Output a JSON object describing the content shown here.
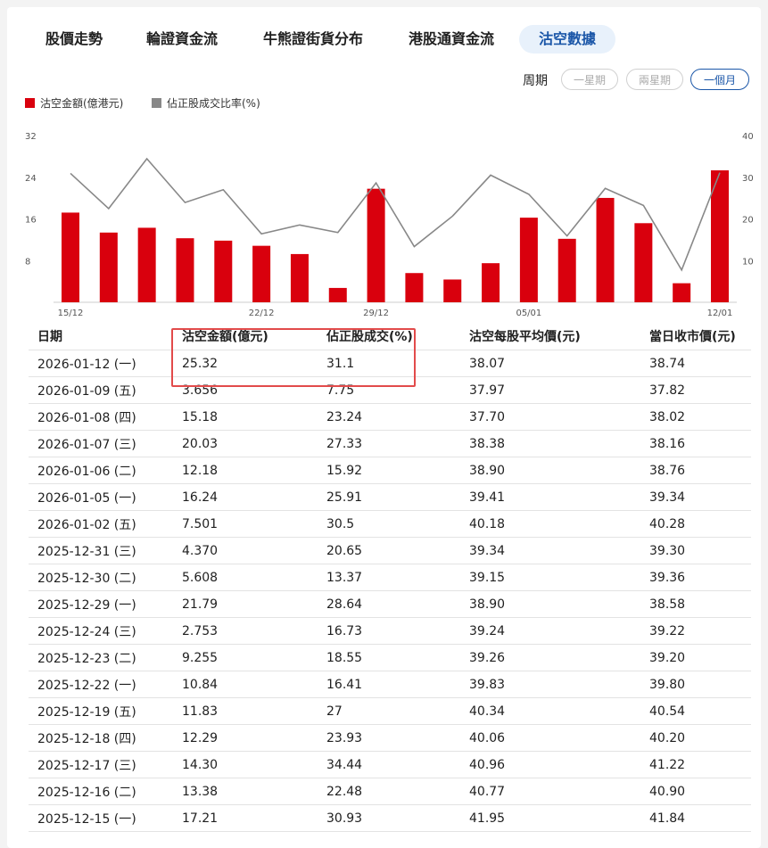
{
  "tabs": [
    "股價走勢",
    "輪證資金流",
    "牛熊證街貨分布",
    "港股通資金流",
    "沽空數據"
  ],
  "active_tab": 4,
  "period": {
    "label": "周期",
    "options": [
      "一星期",
      "兩星期",
      "一個月"
    ],
    "selected": 2
  },
  "legend": {
    "bar": "沽空金額(億港元)",
    "line": "佔正股成交比率(%)"
  },
  "colors": {
    "bar": "#d9000d",
    "line": "#888888",
    "accent": "#1a56a8",
    "highlight": "#e24b4b"
  },
  "chart_data": {
    "type": "bar",
    "x": [
      "2025-12-15",
      "2025-12-16",
      "2025-12-17",
      "2025-12-18",
      "2025-12-19",
      "2025-12-22",
      "2025-12-23",
      "2025-12-24",
      "2025-12-29",
      "2025-12-30",
      "2025-12-31",
      "2026-01-02",
      "2026-01-05",
      "2026-01-06",
      "2026-01-07",
      "2026-01-08",
      "2026-01-09",
      "2026-01-12"
    ],
    "x_tick_labels": [
      "15/12",
      "22/12",
      "29/12",
      "05/01",
      "12/01"
    ],
    "x_tick_indices": [
      0,
      5,
      8,
      12,
      17
    ],
    "series": [
      {
        "name": "沽空金額(億港元)",
        "type": "bar",
        "axis": "left",
        "values": [
          17.21,
          13.38,
          14.3,
          12.29,
          11.83,
          10.84,
          9.255,
          2.753,
          21.79,
          5.608,
          4.37,
          7.501,
          16.24,
          12.18,
          20.03,
          15.18,
          3.656,
          25.32
        ]
      },
      {
        "name": "佔正股成交比率(%)",
        "type": "line",
        "axis": "right",
        "values": [
          30.93,
          22.48,
          34.44,
          23.93,
          27,
          16.41,
          18.55,
          16.73,
          28.64,
          13.37,
          20.65,
          30.5,
          25.91,
          15.92,
          27.33,
          23.24,
          7.75,
          31.1
        ]
      }
    ],
    "y_left": {
      "ticks": [
        8,
        16,
        24,
        32
      ],
      "lim": [
        0,
        32
      ]
    },
    "y_right": {
      "ticks": [
        10,
        20,
        30,
        40
      ],
      "lim": [
        0,
        40
      ]
    }
  },
  "table": {
    "headers": [
      "日期",
      "沽空金額(億元)",
      "佔正股成交(%)",
      "沽空每股平均價(元)",
      "當日收市價(元)"
    ],
    "rows": [
      [
        "2026-01-12 (一)",
        "25.32",
        "31.1",
        "38.07",
        "38.74"
      ],
      [
        "2026-01-09 (五)",
        "3.656",
        "7.75",
        "37.97",
        "37.82"
      ],
      [
        "2026-01-08 (四)",
        "15.18",
        "23.24",
        "37.70",
        "38.02"
      ],
      [
        "2026-01-07 (三)",
        "20.03",
        "27.33",
        "38.38",
        "38.16"
      ],
      [
        "2026-01-06 (二)",
        "12.18",
        "15.92",
        "38.90",
        "38.76"
      ],
      [
        "2026-01-05 (一)",
        "16.24",
        "25.91",
        "39.41",
        "39.34"
      ],
      [
        "2026-01-02 (五)",
        "7.501",
        "30.5",
        "40.18",
        "40.28"
      ],
      [
        "2025-12-31 (三)",
        "4.370",
        "20.65",
        "39.34",
        "39.30"
      ],
      [
        "2025-12-30 (二)",
        "5.608",
        "13.37",
        "39.15",
        "39.36"
      ],
      [
        "2025-12-29 (一)",
        "21.79",
        "28.64",
        "38.90",
        "38.58"
      ],
      [
        "2025-12-24 (三)",
        "2.753",
        "16.73",
        "39.24",
        "39.22"
      ],
      [
        "2025-12-23 (二)",
        "9.255",
        "18.55",
        "39.26",
        "39.20"
      ],
      [
        "2025-12-22 (一)",
        "10.84",
        "16.41",
        "39.83",
        "39.80"
      ],
      [
        "2025-12-19 (五)",
        "11.83",
        "27",
        "40.34",
        "40.54"
      ],
      [
        "2025-12-18 (四)",
        "12.29",
        "23.93",
        "40.06",
        "40.20"
      ],
      [
        "2025-12-17 (三)",
        "14.30",
        "34.44",
        "40.96",
        "41.22"
      ],
      [
        "2025-12-16 (二)",
        "13.38",
        "22.48",
        "40.77",
        "40.90"
      ],
      [
        "2025-12-15 (一)",
        "17.21",
        "30.93",
        "41.95",
        "41.84"
      ]
    ]
  }
}
